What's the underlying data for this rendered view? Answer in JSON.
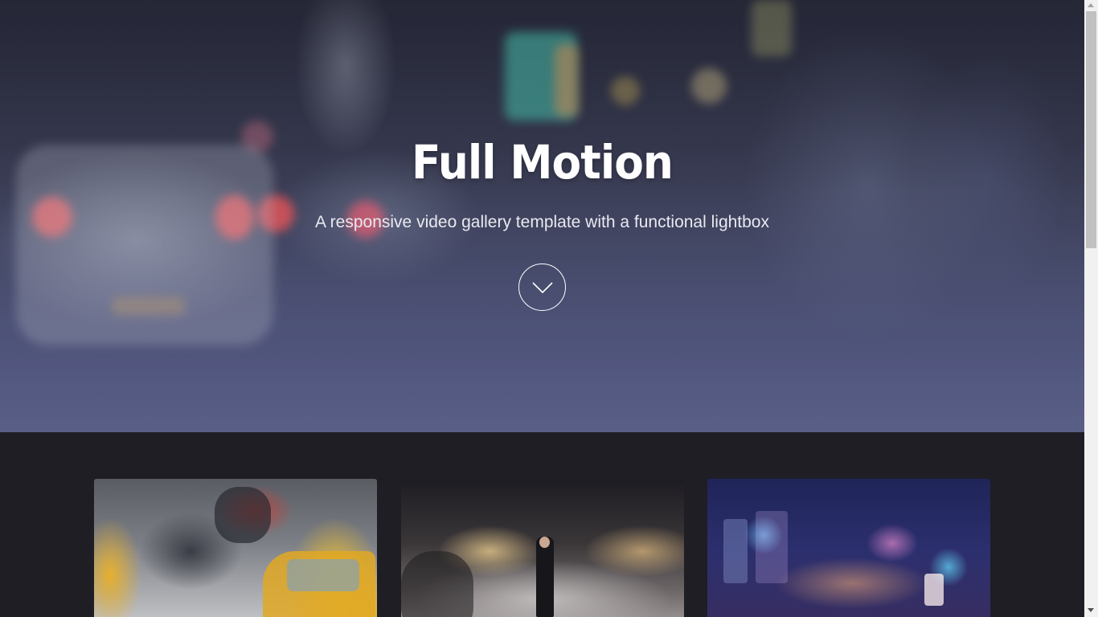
{
  "hero": {
    "title": "Full Motion",
    "subtitle": "A responsive video gallery template with a functional lightbox",
    "scroll_button_icon": "chevron-down-icon"
  },
  "gallery": {
    "thumbnails": [
      {
        "subject": "yellow taxis in traffic"
      },
      {
        "subject": "man crossing city street at night"
      },
      {
        "subject": "blurred city lights at night"
      }
    ]
  },
  "colors": {
    "hero_overlay": "#585c80",
    "gallery_background": "#1e1e24",
    "text": "#ffffff"
  }
}
